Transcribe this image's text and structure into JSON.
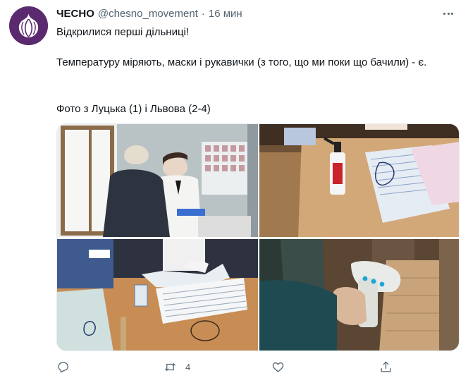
{
  "tweet": {
    "author_name": "ЧЕСНО",
    "handle": "@chesno_movement",
    "separator": "·",
    "time": "16 мин",
    "text_line1": "Відкрилися перші дільниці!",
    "text_line2": "Температуру міряють, маски і рукавички (з того, що ми поки що бачили) - є.",
    "text_line3": "Фото з Луцька (1) і Львова (2-4)"
  },
  "actions": {
    "reply_icon": "reply-icon",
    "retweet_icon": "retweet-icon",
    "retweet_count": "4",
    "like_icon": "heart-icon",
    "share_icon": "share-icon"
  },
  "colors": {
    "brand": "#5b2a6e",
    "text": "#0f1419",
    "muted": "#536471"
  }
}
